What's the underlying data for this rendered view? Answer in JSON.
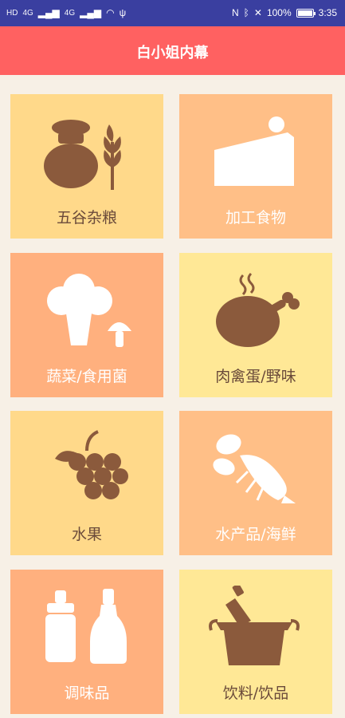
{
  "status_bar": {
    "left": [
      "HD",
      "4G",
      "4G"
    ],
    "battery": "100%",
    "time": "3:35"
  },
  "app_bar": {
    "title": "白小姐内幕"
  },
  "categories": [
    {
      "label": "五谷杂粮",
      "icon": "grain-sack-icon",
      "bg": "#ffd98a",
      "icon_color": "#8b5a3c",
      "text_color": "#6a4a3a"
    },
    {
      "label": "加工食物",
      "icon": "cake-icon",
      "bg": "#ffbf87",
      "icon_color": "#ffffff",
      "text_color": "#ffffff"
    },
    {
      "label": "蔬菜/食用菌",
      "icon": "broccoli-mushroom-icon",
      "bg": "#ffb07e",
      "icon_color": "#ffffff",
      "text_color": "#ffffff"
    },
    {
      "label": "肉禽蛋/野味",
      "icon": "roast-chicken-icon",
      "bg": "#ffe896",
      "icon_color": "#8b5a3c",
      "text_color": "#6a4a3a"
    },
    {
      "label": "水果",
      "icon": "grapes-icon",
      "bg": "#ffd98a",
      "icon_color": "#8b5a3c",
      "text_color": "#6a4a3a"
    },
    {
      "label": "水产品/海鲜",
      "icon": "lobster-icon",
      "bg": "#ffbf87",
      "icon_color": "#ffffff",
      "text_color": "#ffffff"
    },
    {
      "label": "调味品",
      "icon": "condiment-bottles-icon",
      "bg": "#ffb07e",
      "icon_color": "#ffffff",
      "text_color": "#ffffff"
    },
    {
      "label": "饮料/饮品",
      "icon": "wine-bucket-icon",
      "bg": "#ffe896",
      "icon_color": "#8b5a3c",
      "text_color": "#6a4a3a"
    }
  ]
}
